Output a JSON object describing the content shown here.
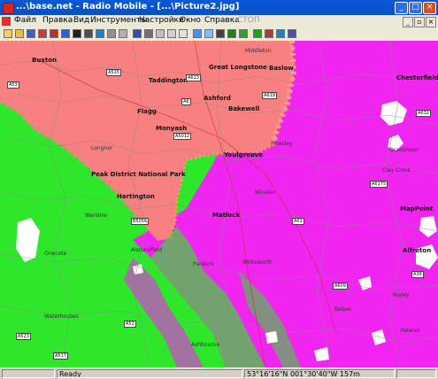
{
  "window": {
    "title": "...\\base.net - Radio Mobile - [...\\Picture2.jpg]"
  },
  "menu": [
    "Файл",
    "Правка",
    "Вид",
    "Инструменты",
    "Настройки",
    "Окно",
    "Справка",
    "СТОП"
  ],
  "toolbar": {
    "tools": [
      "new-icon",
      "open-icon",
      "save-icon",
      "properties-icon",
      "networks-icon",
      "units-icon",
      "systems-icon",
      "map-icon",
      "world-icon",
      "picture-icon",
      "grid-icon",
      "merge-icon",
      "print-icon",
      "copy-icon",
      "paste-icon",
      "radio-link-icon",
      "coverage-icon",
      "route-icon",
      "visual-icon",
      "contour-icon",
      "fresnel-icon",
      "cursor-icon",
      "antenna-icon",
      "photo-icon",
      "compass-icon"
    ]
  },
  "map": {
    "places": [
      {
        "name": "Buxton",
        "big": true
      },
      {
        "name": "Taddington",
        "big": true
      },
      {
        "name": "Great Longstone",
        "big": true
      },
      {
        "name": "Baslow",
        "big": true
      },
      {
        "name": "Ashford",
        "big": true
      },
      {
        "name": "Flagg",
        "big": true
      },
      {
        "name": "Monyash",
        "big": true
      },
      {
        "name": "Bakewell",
        "big": true
      },
      {
        "name": "Middleton",
        "big": false
      },
      {
        "name": "Youlgreave",
        "big": true
      },
      {
        "name": "Rowsley",
        "big": false
      },
      {
        "name": "Longnor",
        "big": false
      },
      {
        "name": "Peak District National Park",
        "big": true
      },
      {
        "name": "Hartington",
        "big": true
      },
      {
        "name": "Winster",
        "big": false
      },
      {
        "name": "Wirksworth",
        "big": false
      },
      {
        "name": "Matlock",
        "big": true
      },
      {
        "name": "Warslow",
        "big": false
      },
      {
        "name": "Alstonefield",
        "big": false
      },
      {
        "name": "Parwich",
        "big": false
      },
      {
        "name": "Onecote",
        "big": false
      },
      {
        "name": "Waterhouses",
        "big": false
      },
      {
        "name": "Ashbourne",
        "big": false
      },
      {
        "name": "Chesterfield",
        "big": true
      },
      {
        "name": "MapPoint",
        "big": true
      },
      {
        "name": "Alfreton",
        "big": true
      },
      {
        "name": "Belper",
        "big": false
      },
      {
        "name": "Ripley",
        "big": false
      },
      {
        "name": "Clay Cross",
        "big": false
      },
      {
        "name": "Grassmoor",
        "big": false
      },
      {
        "name": "Heanor",
        "big": false
      }
    ],
    "roads": [
      "A53",
      "A515",
      "A6",
      "A623",
      "A619",
      "A5012",
      "B5056",
      "A523",
      "A52",
      "A517",
      "A61",
      "A38",
      "A609",
      "A632",
      "A6175"
    ]
  },
  "status": {
    "text": "Ready",
    "coords": "53°16'16\"N 001°30'40\"W 157m"
  }
}
